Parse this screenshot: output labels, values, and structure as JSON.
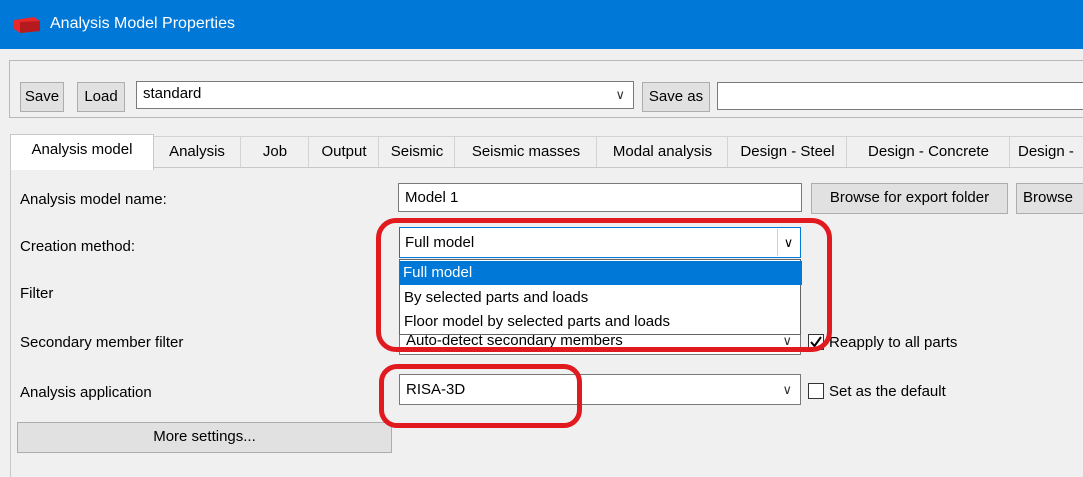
{
  "window": {
    "title": "Analysis Model Properties"
  },
  "toolbar": {
    "save_label": "Save",
    "load_label": "Load",
    "preset_value": "standard",
    "save_as_label": "Save as",
    "save_as_value": ""
  },
  "tabs": [
    {
      "label": "Analysis model",
      "active": true
    },
    {
      "label": "Analysis"
    },
    {
      "label": "Job"
    },
    {
      "label": "Output"
    },
    {
      "label": "Seismic"
    },
    {
      "label": "Seismic masses"
    },
    {
      "label": "Modal analysis"
    },
    {
      "label": "Design - Steel"
    },
    {
      "label": "Design - Concrete"
    },
    {
      "label": "Design -"
    }
  ],
  "form": {
    "model_name_label": "Analysis model name:",
    "model_name_value": "Model 1",
    "browse_export_label": "Browse for export folder",
    "browse_label": "Browse",
    "creation_method_label": "Creation method:",
    "creation_method_value": "Full model",
    "creation_method_options": [
      "Full model",
      "By selected parts and loads",
      "Floor model by selected parts and loads"
    ],
    "filter_label": "Filter",
    "secondary_filter_label": "Secondary member filter",
    "secondary_filter_value": "Auto-detect secondary members",
    "reapply_label": "Reapply to all parts",
    "reapply_checked": true,
    "analysis_app_label": "Analysis application",
    "analysis_app_value": "RISA-3D",
    "set_default_label": "Set as the default",
    "set_default_checked": false,
    "more_settings_label": "More settings..."
  },
  "colors": {
    "titlebar": "#0078d7",
    "highlight": "#0078d7",
    "annotation": "#e01a1f"
  },
  "icons": {
    "app": "app-logo-icon",
    "dropdown": "chevron-down-icon",
    "check": "checkmark-icon"
  }
}
